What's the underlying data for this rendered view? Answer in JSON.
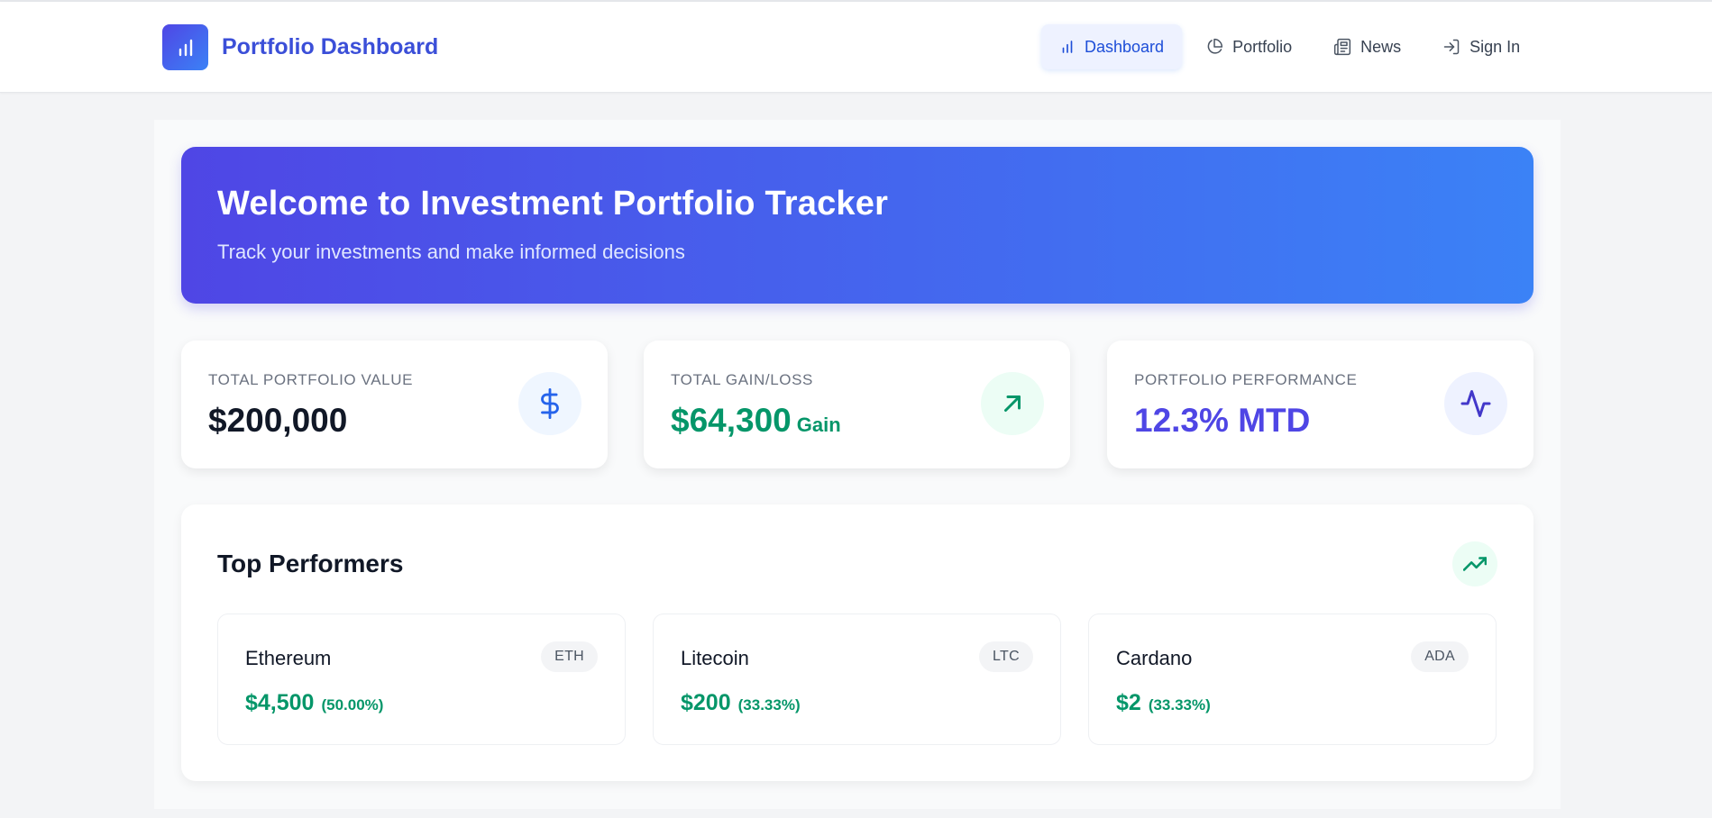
{
  "app": {
    "title": "Portfolio Dashboard",
    "icon": "bar-chart-icon",
    "brand_color": "#3b4fd8"
  },
  "nav": {
    "items": [
      {
        "label": "Dashboard",
        "icon": "bar-chart-icon",
        "active": true
      },
      {
        "label": "Portfolio",
        "icon": "pie-chart-icon",
        "active": false
      },
      {
        "label": "News",
        "icon": "newspaper-icon",
        "active": false
      },
      {
        "label": "Sign In",
        "icon": "sign-in-icon",
        "active": false
      }
    ]
  },
  "hero": {
    "title": "Welcome to Investment Portfolio Tracker",
    "subtitle": "Track your investments and make informed decisions",
    "gradient": [
      "#4f46e5",
      "#3b82f6"
    ]
  },
  "stats": [
    {
      "label": "TOTAL PORTFOLIO VALUE",
      "value": "$200,000",
      "suffix": "",
      "icon": "dollar-icon",
      "color": "#111827",
      "icon_color": "#2563eb",
      "icon_bg": "#eff6ff"
    },
    {
      "label": "TOTAL GAIN/LOSS",
      "value": "$64,300",
      "suffix": "Gain",
      "icon": "arrow-up-right-icon",
      "color": "#059669",
      "icon_color": "#059669",
      "icon_bg": "#ecfdf5"
    },
    {
      "label": "PORTFOLIO PERFORMANCE",
      "value": "12.3% MTD",
      "suffix": "",
      "icon": "activity-icon",
      "color": "#4f46e5",
      "icon_color": "#4338ca",
      "icon_bg": "#eef2ff"
    }
  ],
  "top_performers": {
    "title": "Top Performers",
    "icon": "trending-up-icon",
    "assets": [
      {
        "name": "Ethereum",
        "ticker": "ETH",
        "price": "$4,500",
        "change": "(50.00%)"
      },
      {
        "name": "Litecoin",
        "ticker": "LTC",
        "price": "$200",
        "change": "(33.33%)"
      },
      {
        "name": "Cardano",
        "ticker": "ADA",
        "price": "$2",
        "change": "(33.33%)"
      }
    ],
    "positive_color": "#059669"
  }
}
